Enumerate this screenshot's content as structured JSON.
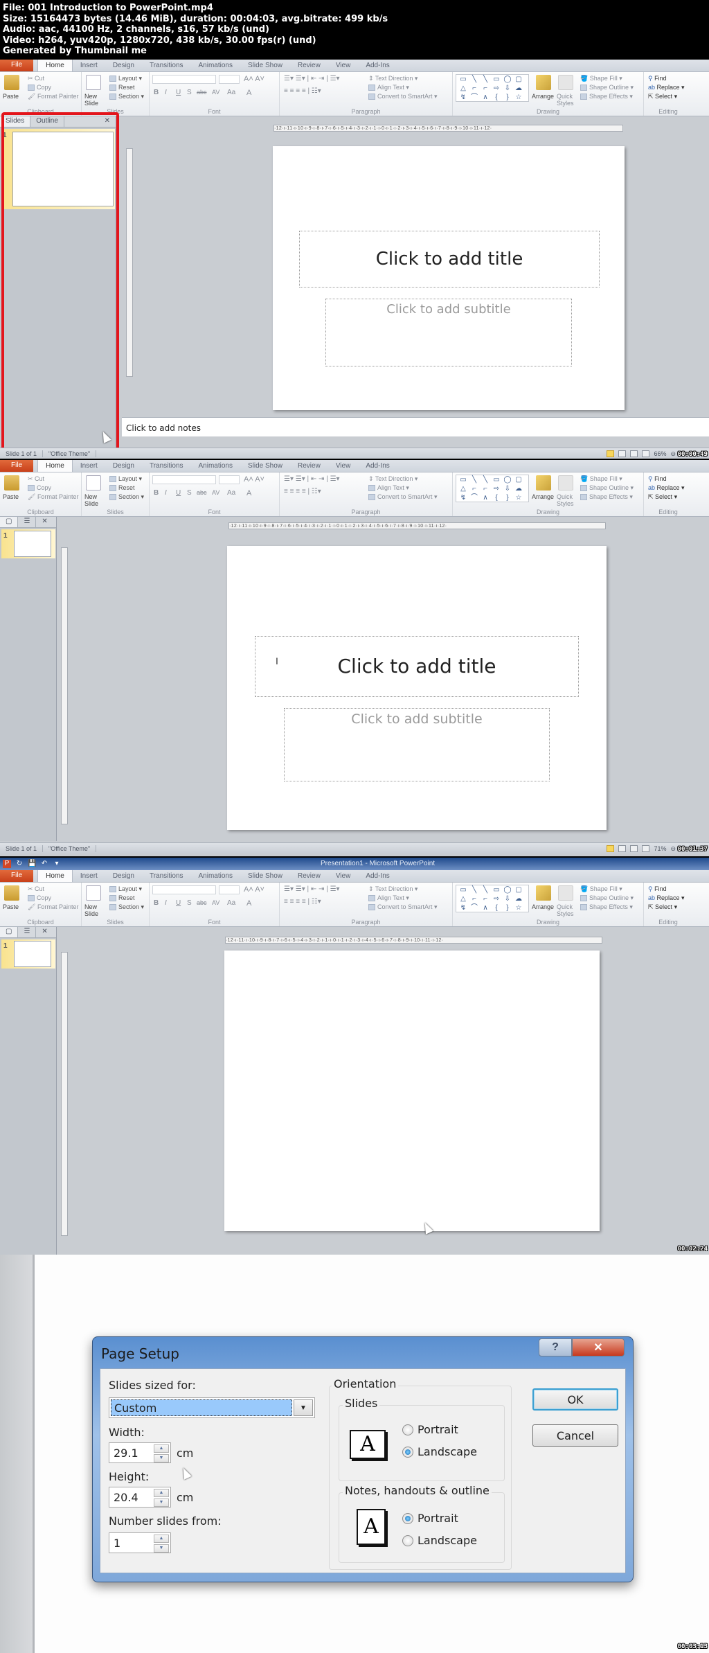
{
  "file_info": {
    "line1": "File: 001 Introduction to PowerPoint.mp4",
    "line2": "Size: 15164473 bytes (14.46 MiB), duration: 00:04:03, avg.bitrate: 499 kb/s",
    "line3": "Audio: aac, 44100 Hz, 2 channels, s16, 57 kb/s (und)",
    "line4": "Video: h264, yuv420p, 1280x720, 438 kb/s, 30.00 fps(r) (und)",
    "line5": "Generated by Thumbnail me"
  },
  "app": {
    "window_title": "Presentation1 - Microsoft PowerPoint",
    "ribbon_tabs": [
      "File",
      "Home",
      "Insert",
      "Design",
      "Transitions",
      "Animations",
      "Slide Show",
      "Review",
      "View",
      "Add-Ins"
    ],
    "active_tab": "Home",
    "clipboard": {
      "paste": "Paste",
      "cut": "Cut",
      "copy": "Copy",
      "format_painter": "Format Painter",
      "label": "Clipboard"
    },
    "slides_group": {
      "new_slide": "New Slide",
      "layout": "Layout",
      "reset": "Reset",
      "section": "Section",
      "label": "Slides"
    },
    "font_group": {
      "label": "Font",
      "bold": "B",
      "italic": "I",
      "underline": "U",
      "strike": "S",
      "abc": "abc",
      "spacing": "AV",
      "case": "Aa",
      "color": "A"
    },
    "paragraph_group": {
      "label": "Paragraph",
      "text_direction": "Text Direction",
      "align_text": "Align Text",
      "convert_smartart": "Convert to SmartArt"
    },
    "drawing_group": {
      "label": "Drawing",
      "arrange": "Arrange",
      "quick_styles": "Quick Styles",
      "shape_fill": "Shape Fill",
      "shape_outline": "Shape Outline",
      "shape_effects": "Shape Effects"
    },
    "editing_group": {
      "label": "Editing",
      "find": "Find",
      "replace": "Replace",
      "select": "Select"
    },
    "shapes": [
      "▭",
      "╲",
      "╲",
      "▭",
      "◯",
      "▢",
      "△",
      "⌐",
      "⌐",
      "⇨",
      "⇩",
      "☁",
      "↯",
      "⌒",
      "∧",
      "{",
      "}",
      "☆"
    ],
    "ruler_text": "·12·ı·11·ı·10·ı·9·ı·8·ı·7·ı·6·ı·5·ı·4·ı·3·ı·2·ı·1·ı·0·ı·1·ı·2·ı·3·ı·4·ı·5·ı·6·ı·7·ı·8·ı·9·ı·10·ı·11·ı·12·"
  },
  "frames": [
    {
      "pane_tabs": [
        "Slides",
        "Outline"
      ],
      "slide_number": "1",
      "title_placeholder": "Click to add title",
      "subtitle_placeholder": "Click to add subtitle",
      "notes_placeholder": "Click to add notes",
      "status_slide": "Slide 1 of 1",
      "status_theme": "\"Office Theme\"",
      "zoom": "66%",
      "timestamp": "00:00:49"
    },
    {
      "slide_number": "1",
      "title_placeholder": "Click to add title",
      "subtitle_placeholder": "Click to add subtitle",
      "status_slide": "Slide 1 of 1",
      "status_theme": "\"Office Theme\"",
      "zoom": "71%",
      "timestamp": "00:01:37"
    },
    {
      "slide_number": "1",
      "timestamp": "00:02:24"
    }
  ],
  "page_setup": {
    "title": "Page Setup",
    "help": "?",
    "close": "✕",
    "slides_sized_for_label": "Slides sized for:",
    "slides_sized_for_value": "Custom",
    "width_label": "Width:",
    "width_value": "29.1",
    "height_label": "Height:",
    "height_value": "20.4",
    "unit": "cm",
    "number_from_label": "Number slides from:",
    "number_from_value": "1",
    "orientation_label": "Orientation",
    "slides_label": "Slides",
    "slides_portrait": "Portrait",
    "slides_landscape": "Landscape",
    "slides_selected": "Landscape",
    "notes_label": "Notes, handouts & outline",
    "notes_portrait": "Portrait",
    "notes_landscape": "Landscape",
    "notes_selected": "Portrait",
    "ok": "OK",
    "cancel": "Cancel",
    "timestamp": "00:03:13"
  },
  "colors": {
    "file_tab": "#d24726",
    "highlight_red": "#e3151c",
    "selection_blue": "#99c9fb"
  }
}
